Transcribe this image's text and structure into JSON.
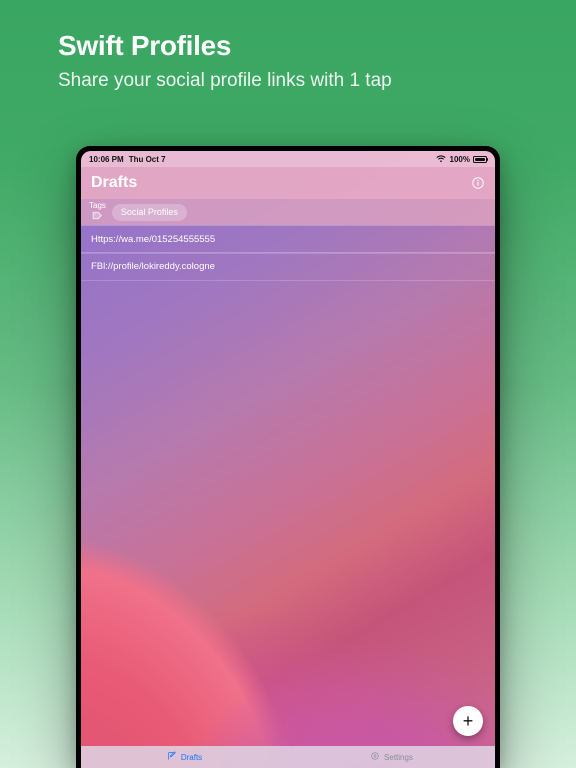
{
  "promo": {
    "title": "Swift Profiles",
    "subtitle": "Share your social profile links with 1 tap"
  },
  "statusbar": {
    "time": "10:06 PM",
    "date": "Thu Oct 7",
    "battery_pct": "100%"
  },
  "navbar": {
    "title": "Drafts"
  },
  "tags": {
    "label": "Tags",
    "chips": [
      "Social Profiles"
    ]
  },
  "drafts": [
    "Https://wa.me/015254555555",
    "FBl://profile/lokireddy.cologne"
  ],
  "fab": {
    "glyph": "+"
  },
  "tabs": {
    "drafts": "Drafts",
    "settings": "Settings"
  }
}
